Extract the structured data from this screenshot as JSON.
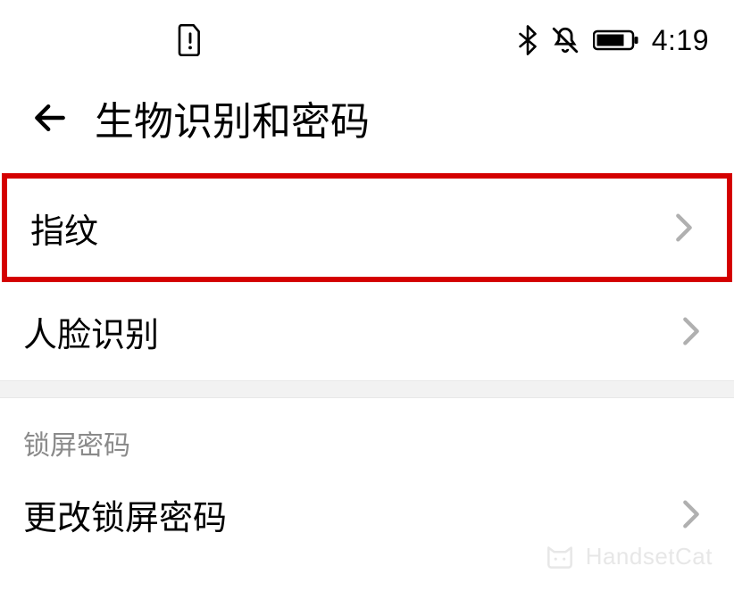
{
  "status": {
    "time": "4:19"
  },
  "header": {
    "title": "生物识别和密码"
  },
  "items": {
    "fingerprint": "指纹",
    "face": "人脸识别"
  },
  "section": {
    "lockscreen_header": "锁屏密码",
    "change_password": "更改锁屏密码"
  },
  "watermark": {
    "text": "HandsetCat"
  }
}
